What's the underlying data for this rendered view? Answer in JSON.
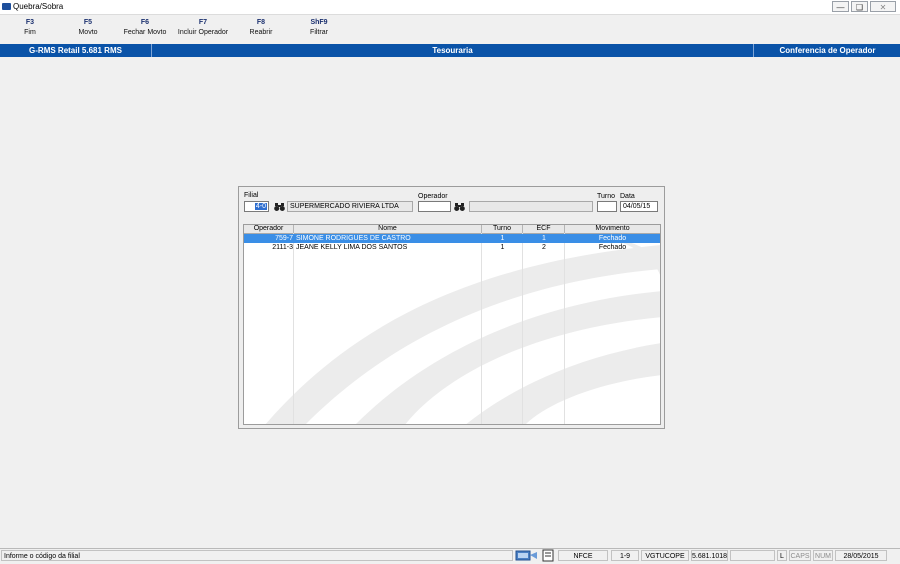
{
  "window": {
    "title": "Quebra/Sobra"
  },
  "toolbar": {
    "items": [
      {
        "key": "F3",
        "label": "Fim"
      },
      {
        "key": "F5",
        "label": "Movto"
      },
      {
        "key": "F6",
        "label": "Fechar Movto"
      },
      {
        "key": "F7",
        "label": "Incluir Operador"
      },
      {
        "key": "F8",
        "label": "Reabrir"
      },
      {
        "key": "ShF9",
        "label": "Filtrar"
      }
    ]
  },
  "header": {
    "app": "G-RMS Retail 5.681 RMS",
    "module": "Tesouraria",
    "screen": "Conferencia de Operador"
  },
  "filters": {
    "filial_label": "Filial",
    "filial_code": "4-0",
    "filial_name": "SUPERMERCADO RIVIERA LTDA",
    "operador_label": "Operador",
    "operador_code": "",
    "operador_name": "",
    "turno_label": "Turno",
    "turno_value": "",
    "data_label": "Data",
    "data_value": "04/05/15"
  },
  "grid": {
    "columns": [
      "Operador",
      "Nome",
      "Turno",
      "ECF",
      "Movimento"
    ],
    "rows": [
      {
        "operador": "759-7",
        "nome": "SIMONE RODRIGUES DE CASTRO",
        "turno": "1",
        "ecf": "1",
        "movimento": "Fechado",
        "selected": true
      },
      {
        "operador": "2111-3",
        "nome": "JEANE KELLY LIMA DOS SANTOS",
        "turno": "1",
        "ecf": "2",
        "movimento": "Fechado",
        "selected": false
      }
    ]
  },
  "status": {
    "message": "Informe o código da filial",
    "mode": "NFCE",
    "range": "1-9",
    "program": "VGTUCOPE",
    "version": "5.681.1018",
    "blank": "",
    "l_flag": "L",
    "caps": "CAPS",
    "num": "NUM",
    "date": "28/05/2015"
  },
  "colors": {
    "header_blue": "#0a53a8",
    "selection_blue": "#3a8ee6",
    "toolbar_key": "#1a2f6e"
  }
}
